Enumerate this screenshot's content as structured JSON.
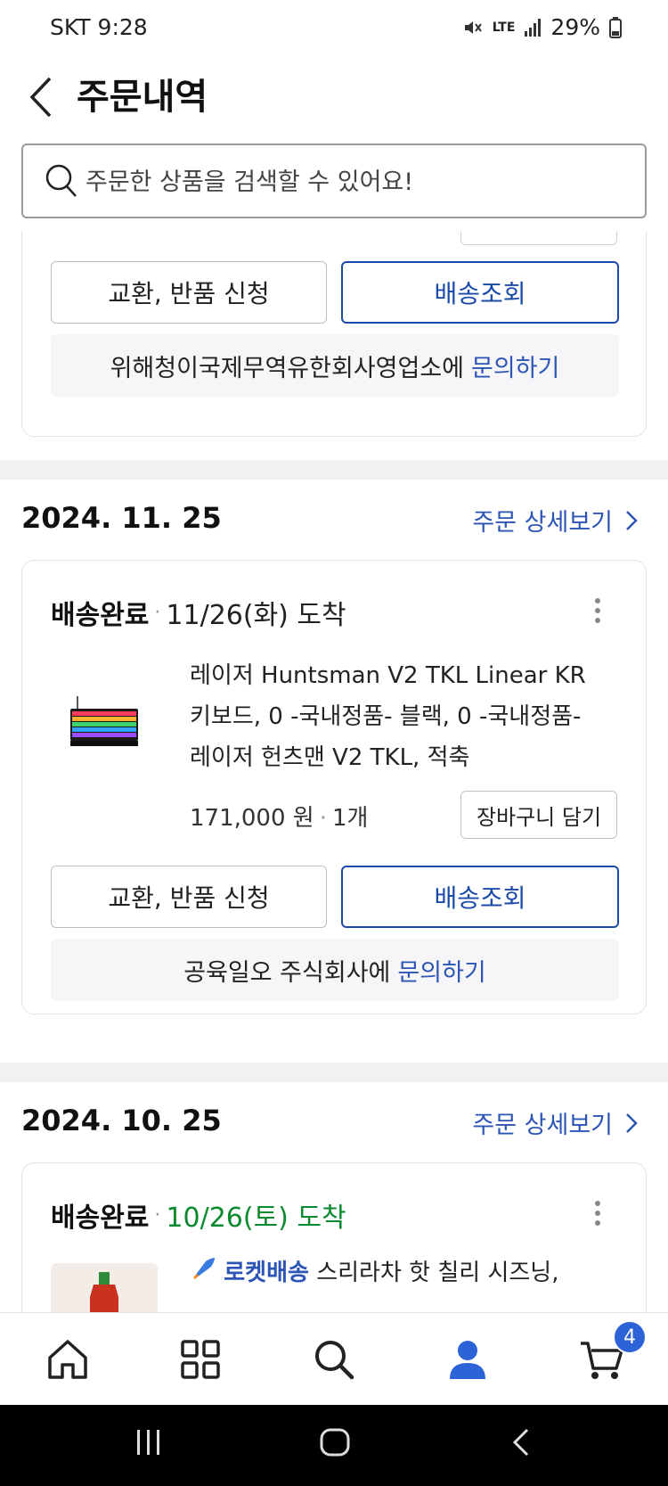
{
  "status_bar": {
    "carrier_time": "SKT 9:28",
    "network": "LTE",
    "battery": "29%"
  },
  "header": {
    "title": "주문내역"
  },
  "search": {
    "placeholder": "주문한 상품을 검색할 수 있어요!"
  },
  "partial_order": {
    "exchange_label": "교환, 반품 신청",
    "tracking_label": "배송조회",
    "inquiry_seller": "위해청이국제무역유한회사영업소에",
    "inquiry_link": "문의하기"
  },
  "orders": [
    {
      "date": "2024. 11. 25",
      "detail_label": "주문 상세보기",
      "status": "배송완료",
      "arrival": "11/26(화) 도착",
      "product_name": "레이저 Huntsman V2 TKL Linear KR 키보드, 0 -국내정품- 블랙, 0 -국내정품- 레이저 헌츠맨 V2 TKL, 적축",
      "price": "171,000 원",
      "quantity": "1개",
      "cart_label": "장바구니 담기",
      "exchange_label": "교환, 반품 신청",
      "tracking_label": "배송조회",
      "inquiry_seller": "공육일오 주식회사에",
      "inquiry_link": "문의하기"
    },
    {
      "date": "2024. 10. 25",
      "detail_label": "주문 상세보기",
      "status": "배송완료",
      "arrival": "10/26(토) 도착",
      "rocket_label": "로켓배송",
      "product_name": "스리라차 핫 칠리 시즈닝,"
    }
  ],
  "bottom_nav": {
    "items": [
      "home-icon",
      "category-icon",
      "search-icon",
      "my-page-icon",
      "cart-icon"
    ],
    "cart_count": "4",
    "active_color": "#2c63d6"
  },
  "colors": {
    "accent_blue": "#1b4ba8",
    "link_blue": "#2c55b6",
    "arrival_green": "#0a8a2e"
  }
}
